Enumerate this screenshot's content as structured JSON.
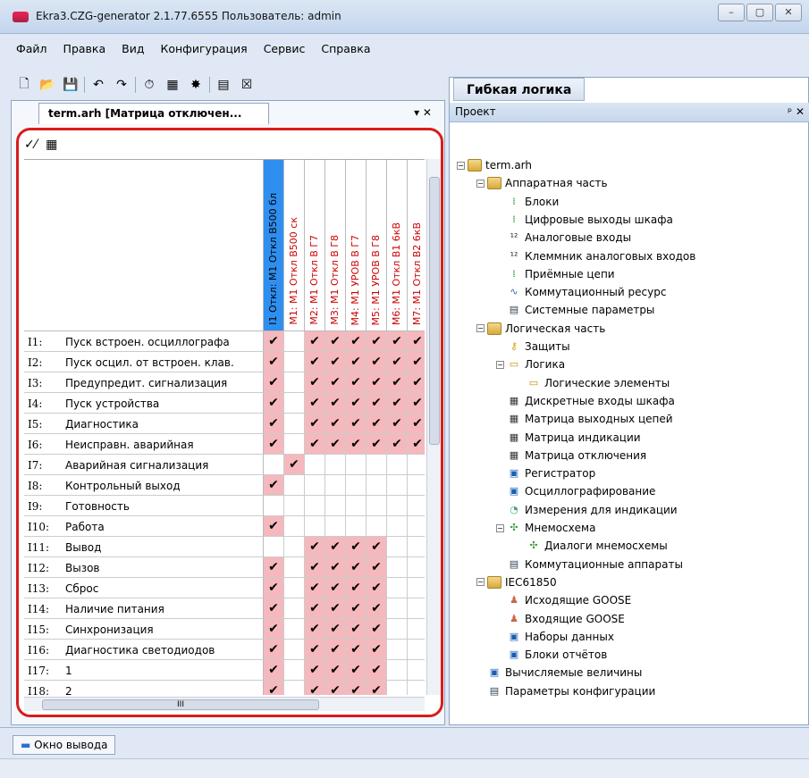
{
  "window": {
    "title": "Ekra3.CZG-generator 2.1.77.6555 Пользователь: admin",
    "buttons": [
      "–",
      "▢",
      "✕"
    ]
  },
  "menu": [
    "Файл",
    "Правка",
    "Вид",
    "Конфигурация",
    "Сервис",
    "Справка"
  ],
  "doc_tab": {
    "label": "term.arh [Матрица отключен...",
    "controls": "▾ ✕"
  },
  "matrix": {
    "columns": [
      "I1 Откл: М1 Откл В500 бл",
      "М1: М1 Откл В500 ск",
      "М2: М1 Откл В Г7",
      "М3: М1 Откл В Г8",
      "М4: М1 УРОВ В Г7",
      "М5: М1 УРОВ В Г8",
      "М6: М1 Откл В1 6кВ",
      "М7: М1 Откл В2 6кВ"
    ],
    "rows": [
      {
        "id": "I1:",
        "name": "Пуск встроен. осциллографа",
        "cells": [
          1,
          0,
          1,
          1,
          1,
          1,
          1,
          1
        ]
      },
      {
        "id": "I2:",
        "name": "Пуск осцил. от встроен. клав.",
        "cells": [
          1,
          0,
          1,
          1,
          1,
          1,
          1,
          1
        ]
      },
      {
        "id": "I3:",
        "name": "Предупредит. сигнализация",
        "cells": [
          1,
          0,
          1,
          1,
          1,
          1,
          1,
          1
        ]
      },
      {
        "id": "I4:",
        "name": "Пуск устройства",
        "cells": [
          1,
          0,
          1,
          1,
          1,
          1,
          1,
          1
        ]
      },
      {
        "id": "I5:",
        "name": "Диагностика",
        "cells": [
          1,
          0,
          1,
          1,
          1,
          1,
          1,
          1
        ]
      },
      {
        "id": "I6:",
        "name": "Неисправн. аварийная",
        "cells": [
          1,
          0,
          1,
          1,
          1,
          1,
          1,
          1
        ]
      },
      {
        "id": "I7:",
        "name": "Аварийная сигнализация",
        "cells": [
          0,
          1,
          0,
          0,
          0,
          0,
          0,
          0
        ]
      },
      {
        "id": "I8:",
        "name": "Контрольный выход",
        "cells": [
          1,
          0,
          0,
          0,
          0,
          0,
          0,
          0
        ]
      },
      {
        "id": "I9:",
        "name": "Готовность",
        "cells": [
          0,
          0,
          0,
          0,
          0,
          0,
          0,
          0
        ]
      },
      {
        "id": "I10:",
        "name": "Работа",
        "cells": [
          1,
          0,
          0,
          0,
          0,
          0,
          0,
          0
        ]
      },
      {
        "id": "I11:",
        "name": "Вывод",
        "cells": [
          0,
          0,
          1,
          1,
          1,
          1,
          0,
          0
        ]
      },
      {
        "id": "I12:",
        "name": "Вызов",
        "cells": [
          1,
          0,
          1,
          1,
          1,
          1,
          0,
          0
        ]
      },
      {
        "id": "I13:",
        "name": "Сброс",
        "cells": [
          1,
          0,
          1,
          1,
          1,
          1,
          0,
          0
        ]
      },
      {
        "id": "I14:",
        "name": "Наличие питания",
        "cells": [
          1,
          0,
          1,
          1,
          1,
          1,
          0,
          0
        ]
      },
      {
        "id": "I15:",
        "name": "Синхронизация",
        "cells": [
          1,
          0,
          1,
          1,
          1,
          1,
          0,
          0
        ]
      },
      {
        "id": "I16:",
        "name": "Диагностика светодиодов",
        "cells": [
          1,
          0,
          1,
          1,
          1,
          1,
          0,
          0
        ]
      },
      {
        "id": "I17:",
        "name": "1",
        "cells": [
          1,
          0,
          1,
          1,
          1,
          1,
          0,
          0
        ]
      },
      {
        "id": "I18:",
        "name": "2",
        "cells": [
          1,
          0,
          1,
          1,
          1,
          1,
          0,
          0
        ]
      }
    ],
    "check_glyph": "✔",
    "hscroll_label": "III"
  },
  "right": {
    "gl_header": "Гибкая логика",
    "project_label": "Проект",
    "project_controls": "ᵖ ✕"
  },
  "tree": [
    {
      "label": "term.arh",
      "level": 0,
      "exp": "−",
      "icon": "folder"
    },
    {
      "label": "Аппаратная часть",
      "level": 1,
      "exp": "−",
      "icon": "folder"
    },
    {
      "label": "Блоки",
      "level": 2,
      "icon": "block"
    },
    {
      "label": "Цифровые выходы шкафа",
      "level": 2,
      "icon": "block"
    },
    {
      "label": "Аналоговые входы",
      "level": 2,
      "icon": "analog"
    },
    {
      "label": "Клеммник аналоговых входов",
      "level": 2,
      "icon": "analog"
    },
    {
      "label": "Приёмные цепи",
      "level": 2,
      "icon": "block-green"
    },
    {
      "label": "Коммутационный ресурс",
      "level": 2,
      "icon": "wave"
    },
    {
      "label": "Системные параметры",
      "level": 2,
      "icon": "list"
    },
    {
      "label": "Логическая часть",
      "level": 1,
      "exp": "−",
      "icon": "folder"
    },
    {
      "label": "Защиты",
      "level": 2,
      "icon": "key"
    },
    {
      "label": "Логика",
      "level": 2,
      "exp": "−",
      "icon": "logic"
    },
    {
      "label": "Логические элементы",
      "level": 3,
      "icon": "logic"
    },
    {
      "label": "Дискретные входы шкафа",
      "level": 2,
      "icon": "matrix"
    },
    {
      "label": "Матрица выходных цепей",
      "level": 2,
      "icon": "matrix"
    },
    {
      "label": "Матрица индикации",
      "level": 2,
      "icon": "matrix"
    },
    {
      "label": "Матрица отключения",
      "level": 2,
      "icon": "matrix"
    },
    {
      "label": "Регистратор",
      "level": 2,
      "icon": "doc"
    },
    {
      "label": "Осциллографирование",
      "level": 2,
      "icon": "doc"
    },
    {
      "label": "Измерения для индикации",
      "level": 2,
      "icon": "meas"
    },
    {
      "label": "Мнемосхема",
      "level": 2,
      "exp": "−",
      "icon": "mnemo"
    },
    {
      "label": "Диалоги мнемосхемы",
      "level": 3,
      "icon": "mnemo"
    },
    {
      "label": "Коммутационные аппараты",
      "level": 2,
      "icon": "list"
    },
    {
      "label": "IEC61850",
      "level": 1,
      "exp": "−",
      "icon": "folder"
    },
    {
      "label": "Исходящие GOOSE",
      "level": 2,
      "icon": "goose"
    },
    {
      "label": "Входящие GOOSE",
      "level": 2,
      "icon": "goose"
    },
    {
      "label": "Наборы данных",
      "level": 2,
      "icon": "doc"
    },
    {
      "label": "Блоки отчётов",
      "level": 2,
      "icon": "doc"
    },
    {
      "label": "Вычисляемые величины",
      "level": 1,
      "icon": "doc"
    },
    {
      "label": "Параметры конфигурации",
      "level": 1,
      "icon": "list"
    }
  ],
  "output_tab": "Окно вывода",
  "colors": {
    "checked_bg": "#f5b8bd",
    "selected_col": "#2f8ff0",
    "frame": "#d81c1c",
    "header_text": "#cc0000"
  }
}
